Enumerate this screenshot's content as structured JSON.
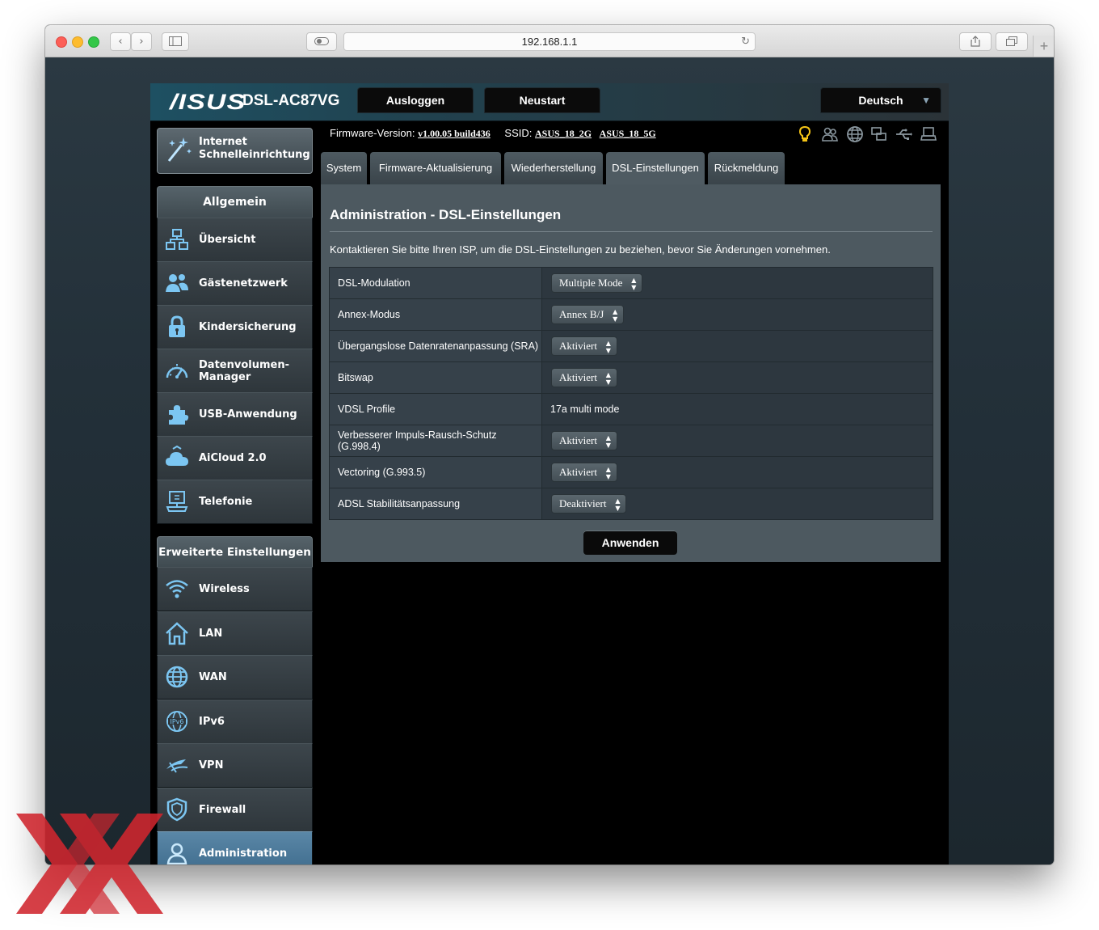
{
  "browser": {
    "url": "192.168.1.1",
    "back_glyph": "‹",
    "forward_glyph": "›",
    "reload_glyph": "↻",
    "new_tab_glyph": "+"
  },
  "router": {
    "brand": "/ISUS",
    "model": "DSL-AC87VG",
    "logout_label": "Ausloggen",
    "reboot_label": "Neustart",
    "language": "Deutsch",
    "firmware_label": "Firmware-Version:",
    "firmware_version": "v1.00.05 build436",
    "ssid_label": "SSID:",
    "ssid_2g": "ASUS_18_2G",
    "ssid_5g": "ASUS_18_5G"
  },
  "sidebar": {
    "qis_label": "Internet Schnelleinrichtung",
    "general_header": "Allgemein",
    "general_items": [
      {
        "label": "Übersicht",
        "icon": "network-map-icon"
      },
      {
        "label": "Gästenetzwerk",
        "icon": "guest-network-icon"
      },
      {
        "label": "Kindersicherung",
        "icon": "parental-lock-icon"
      },
      {
        "label": "Datenvolumen-Manager",
        "icon": "traffic-gauge-icon"
      },
      {
        "label": "USB-Anwendung",
        "icon": "usb-puzzle-icon"
      },
      {
        "label": "AiCloud 2.0",
        "icon": "cloud-icon"
      },
      {
        "label": "Telefonie",
        "icon": "telephony-icon"
      }
    ],
    "advanced_header": "Erweiterte Einstellungen",
    "advanced_items": [
      {
        "label": "Wireless",
        "icon": "wifi-icon"
      },
      {
        "label": "LAN",
        "icon": "home-icon"
      },
      {
        "label": "WAN",
        "icon": "globe-icon"
      },
      {
        "label": "IPv6",
        "icon": "ipv6-icon"
      },
      {
        "label": "VPN",
        "icon": "vpn-icon"
      },
      {
        "label": "Firewall",
        "icon": "shield-icon"
      },
      {
        "label": "Administration",
        "icon": "admin-user-icon"
      }
    ]
  },
  "tabs": [
    "System",
    "Firmware-Aktualisierung",
    "Wiederherstellung",
    "DSL-Einstellungen",
    "Rückmeldung"
  ],
  "active_tab": "DSL-Einstellungen",
  "panel": {
    "title": "Administration - DSL-Einstellungen",
    "description": "Kontaktieren Sie bitte Ihren ISP, um die DSL-Einstellungen zu beziehen, bevor Sie Änderungen vornehmen.",
    "rows": [
      {
        "label": "DSL-Modulation",
        "value": "Multiple Mode"
      },
      {
        "label": "Annex-Modus",
        "value": "Annex B/J"
      },
      {
        "label": "Übergangslose Datenratenanpassung (SRA)",
        "value": "Aktiviert"
      },
      {
        "label": "Bitswap",
        "value": "Aktiviert"
      },
      {
        "label": "VDSL Profile",
        "value": "17a multi mode"
      },
      {
        "label": "Verbesserer Impuls-Rausch-Schutz (G.998.4)",
        "value": "Aktiviert"
      },
      {
        "label": "Vectoring (G.993.5)",
        "value": "Aktiviert"
      },
      {
        "label": "ADSL Stabilitätsanpassung",
        "value": "Deaktiviert"
      }
    ],
    "apply_label": "Anwenden"
  },
  "colors": {
    "watermark": "#d0262e",
    "status_icon_active": "#f3c316",
    "status_icon_idle": "#8b98a0"
  }
}
